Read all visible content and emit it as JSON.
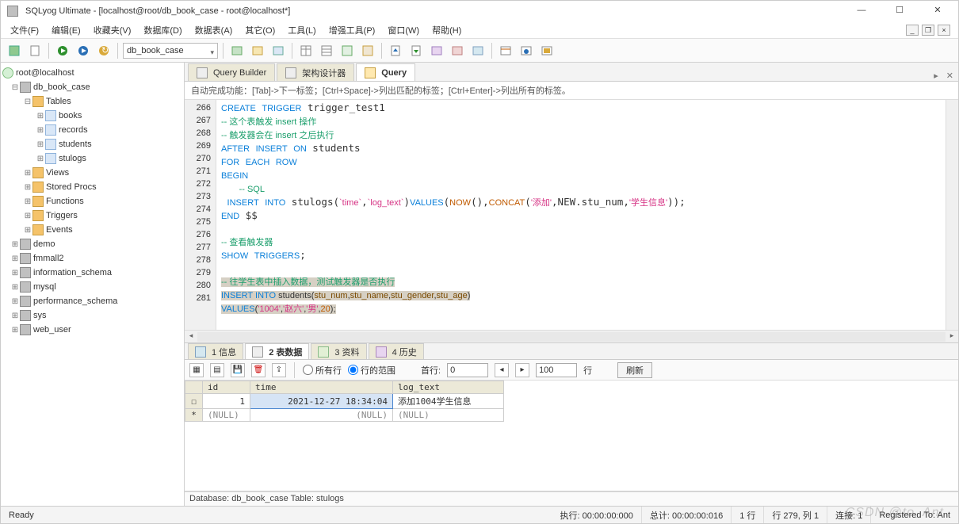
{
  "window": {
    "title": "SQLyog Ultimate - [localhost@root/db_book_case - root@localhost*]",
    "min": "—",
    "max": "☐",
    "close": "✕"
  },
  "menu": {
    "file": "文件(F)",
    "edit": "编辑(E)",
    "fav": "收藏夹(V)",
    "database": "数据库(D)",
    "table": "数据表(A)",
    "other": "其它(O)",
    "tools": "工具(L)",
    "power": "增强工具(P)",
    "window": "窗口(W)",
    "help": "帮助(H)"
  },
  "toolbar": {
    "db_combo": "db_book_case"
  },
  "tree": {
    "root": "root@localhost",
    "db_book_case": "db_book_case",
    "tables": "Tables",
    "t_books": "books",
    "t_records": "records",
    "t_students": "students",
    "t_stulogs": "stulogs",
    "views": "Views",
    "procs": "Stored Procs",
    "funcs": "Functions",
    "triggers": "Triggers",
    "events": "Events",
    "demo": "demo",
    "fmmall2": "fmmall2",
    "infoschema": "information_schema",
    "mysql": "mysql",
    "perfschema": "performance_schema",
    "sys": "sys",
    "webuser": "web_user"
  },
  "uppertabs": {
    "qb": "Query Builder",
    "schema": "架构设计器",
    "query": "Query"
  },
  "hint": "自动完成功能：[Tab]->下一标签；[Ctrl+Space]->列出匹配的标签；[Ctrl+Enter]->列出所有的标签。",
  "gutter": [
    "266",
    "267",
    "268",
    "269",
    "270",
    "271",
    "272",
    "273",
    "274",
    "275",
    "276",
    "277",
    "278",
    "279",
    "280",
    "281"
  ],
  "result_tabs": {
    "info": "1 信息",
    "data": "2 表数据",
    "profile": "3 资料",
    "history": "4 历史"
  },
  "res_toolbar": {
    "all_rows": "所有行",
    "row_range": "行的范围",
    "first_row_lbl": "首行:",
    "first_row_val": "0",
    "count_val": "100",
    "rows_lbl": "行",
    "refresh": "刷新"
  },
  "grid": {
    "cols": {
      "id": "id",
      "time": "time",
      "log": "log_text"
    },
    "row1": {
      "mark": "☐",
      "id": "1",
      "time": "2021-12-27 18:34:04",
      "log": "添加1004学生信息"
    },
    "row2": {
      "mark": "*",
      "id": "(NULL)",
      "time": "(NULL)",
      "log": "(NULL)"
    }
  },
  "db_status": "Database: db_book_case Table: stulogs",
  "status": {
    "ready": "Ready",
    "exec": "执行: 00:00:00:000",
    "total": "总计: 00:00:00:016",
    "rows": "1 行",
    "pos": "行 279, 列 1",
    "conn": "连接: 1",
    "reg": "Registered To: Ant"
  },
  "watermark": "CSDN @to_Ant"
}
